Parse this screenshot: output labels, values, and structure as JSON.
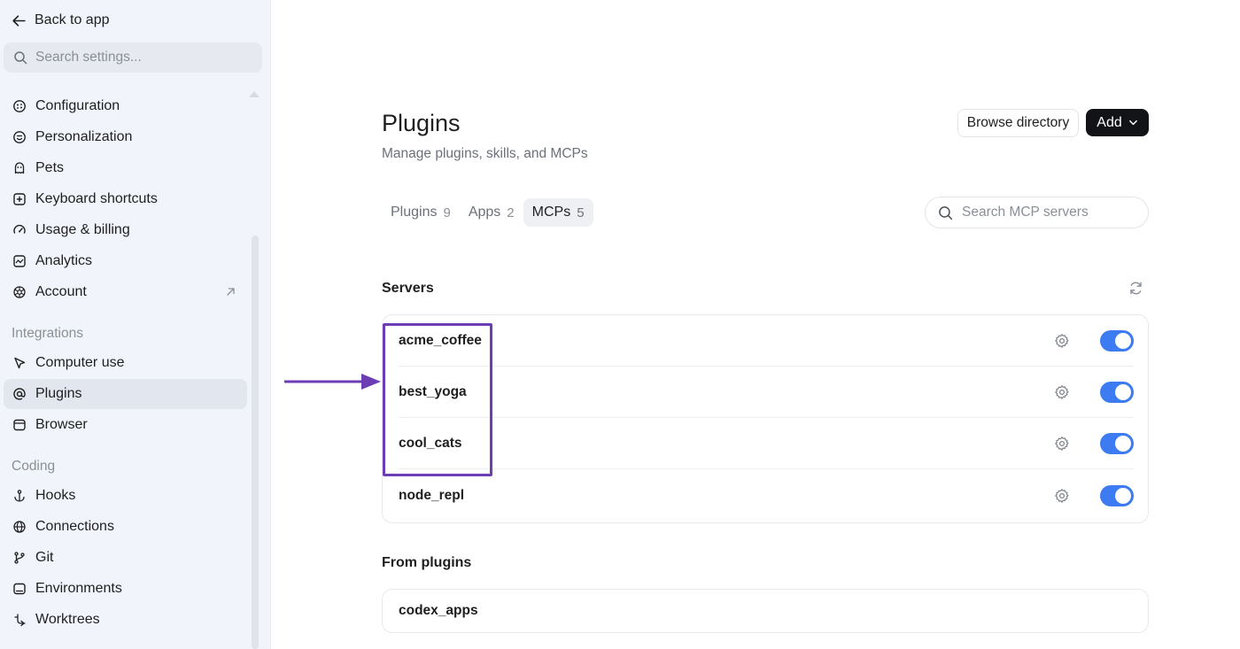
{
  "sidebar": {
    "back_label": "Back to app",
    "search_placeholder": "Search settings...",
    "items_top": [
      {
        "label": "Configuration",
        "icon": "configuration-icon"
      },
      {
        "label": "Personalization",
        "icon": "personalization-icon"
      },
      {
        "label": "Pets",
        "icon": "pets-icon"
      },
      {
        "label": "Keyboard shortcuts",
        "icon": "keyboard-icon"
      },
      {
        "label": "Usage & billing",
        "icon": "gauge-icon"
      },
      {
        "label": "Analytics",
        "icon": "analytics-icon"
      },
      {
        "label": "Account",
        "icon": "account-icon"
      }
    ],
    "section_integrations": "Integrations",
    "items_integrations": [
      {
        "label": "Computer use",
        "icon": "cursor-icon"
      },
      {
        "label": "Plugins",
        "icon": "at-icon",
        "active": true
      },
      {
        "label": "Browser",
        "icon": "browser-icon"
      }
    ],
    "section_coding": "Coding",
    "items_coding": [
      {
        "label": "Hooks",
        "icon": "anchor-icon"
      },
      {
        "label": "Connections",
        "icon": "globe-icon"
      },
      {
        "label": "Git",
        "icon": "git-branch-icon"
      },
      {
        "label": "Environments",
        "icon": "environment-icon"
      },
      {
        "label": "Worktrees",
        "icon": "worktree-icon"
      }
    ]
  },
  "main": {
    "title": "Plugins",
    "subtitle": "Manage plugins, skills, and MCPs",
    "browse_label": "Browse directory",
    "add_label": "Add",
    "tabs": [
      {
        "label": "Plugins",
        "count": "9"
      },
      {
        "label": "Apps",
        "count": "2"
      },
      {
        "label": "MCPs",
        "count": "5",
        "active": true
      }
    ],
    "search_placeholder": "Search MCP servers",
    "servers_label": "Servers",
    "servers": [
      {
        "name": "acme_coffee",
        "enabled": true
      },
      {
        "name": "best_yoga",
        "enabled": true
      },
      {
        "name": "cool_cats",
        "enabled": true
      },
      {
        "name": "node_repl",
        "enabled": true
      }
    ],
    "from_plugins_label": "From plugins",
    "from_plugins": [
      {
        "name": "codex_apps"
      }
    ]
  },
  "colors": {
    "sidebar_bg": "#f1f4fa",
    "toggle_on": "#3c7bf2",
    "add_button": "#111317",
    "annotation": "#6c3db5"
  }
}
